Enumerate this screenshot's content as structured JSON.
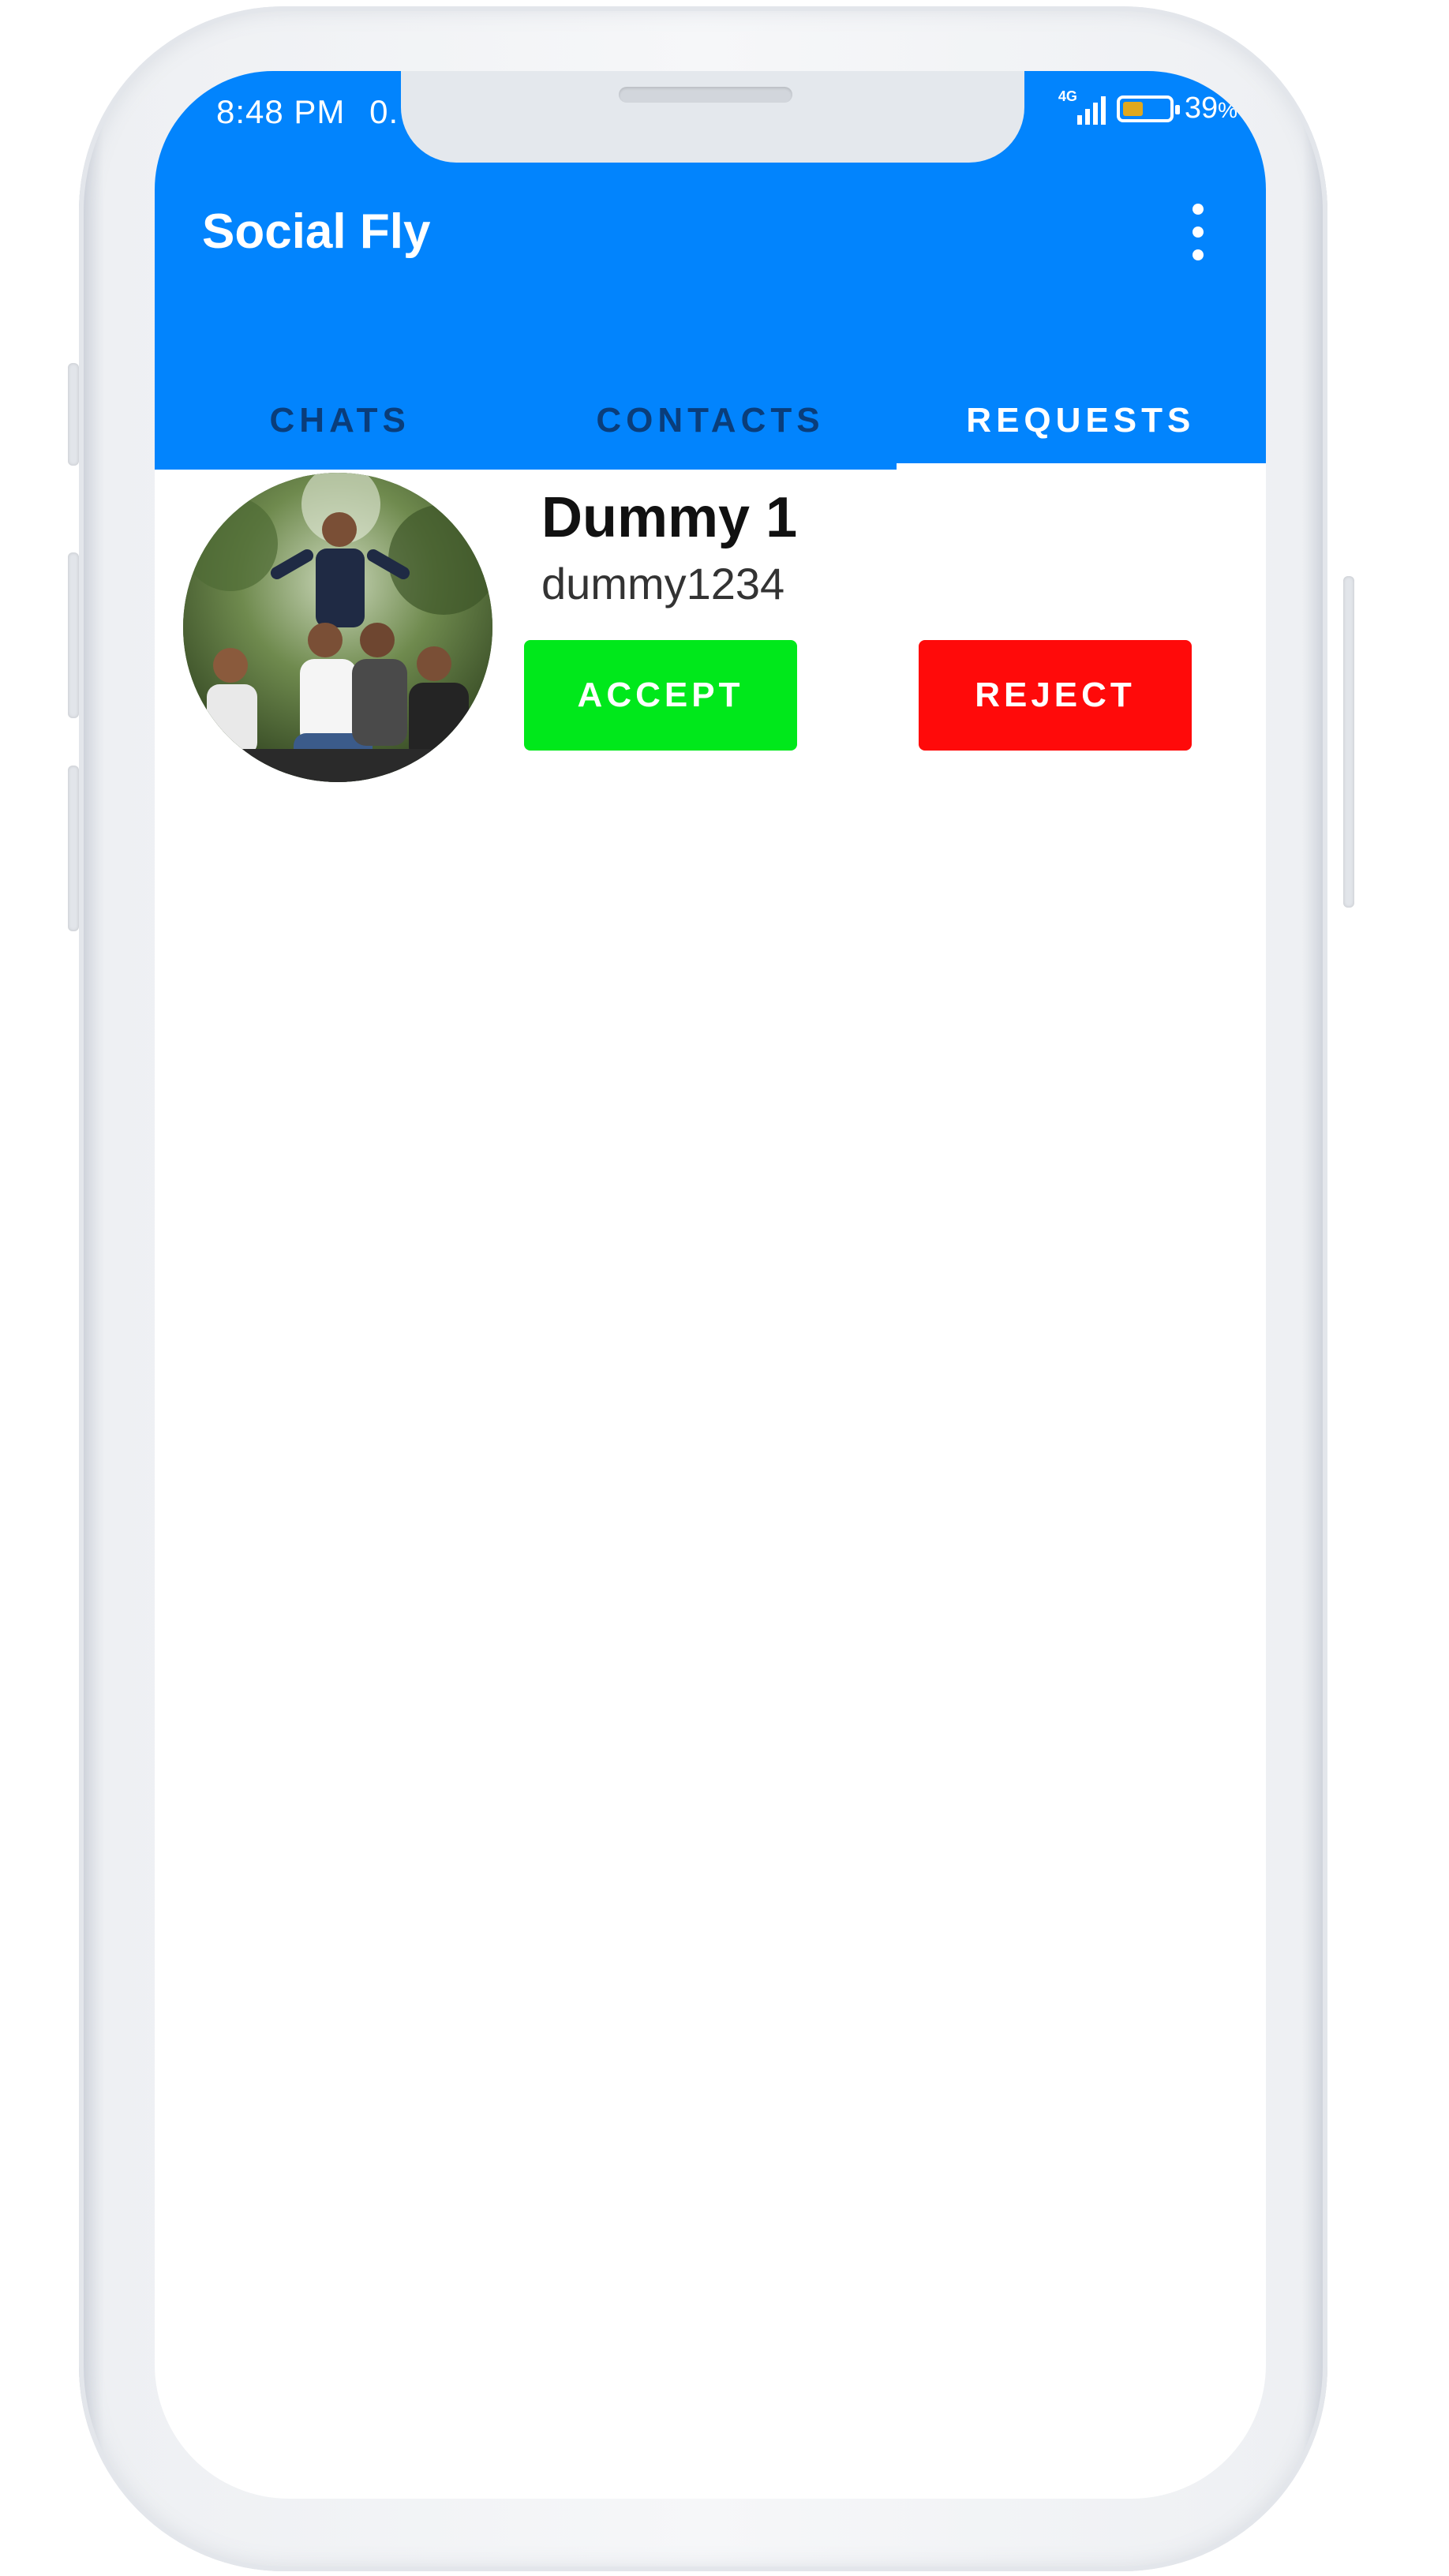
{
  "status_bar": {
    "time": "8:48 PM",
    "network_speed": "0.",
    "network_type": "4G",
    "battery_percent": "39",
    "battery_percent_suffix": "%"
  },
  "app_bar": {
    "title": "Social Fly",
    "menu_icon": "more-vert-icon"
  },
  "tabs": [
    {
      "label": "CHATS",
      "active": false
    },
    {
      "label": "CONTACTS",
      "active": false
    },
    {
      "label": "REQUESTS",
      "active": true
    }
  ],
  "requests": [
    {
      "name": "Dummy 1",
      "username": "dummy1234",
      "accept_label": "ACCEPT",
      "reject_label": "REJECT"
    }
  ],
  "colors": {
    "primary": "#0284fd",
    "accept": "#00e81b",
    "reject": "#ff0a0a",
    "tab_inactive": "#0a3d7a"
  }
}
